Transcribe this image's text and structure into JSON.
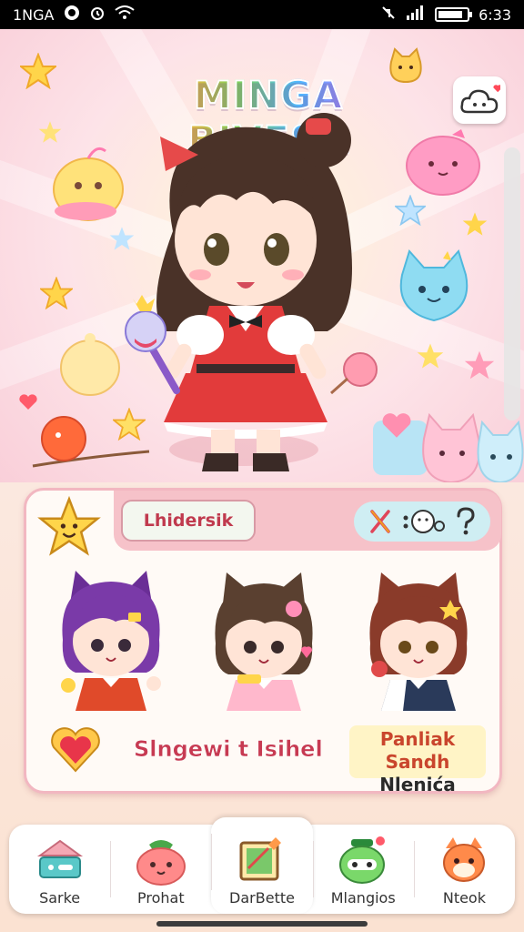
{
  "status_bar": {
    "left_text": "1NGA",
    "time": "6:33",
    "icons": [
      "notification-dot-icon",
      "alarm-icon",
      "wifi-icon",
      "mute-icon",
      "signal-icon",
      "battery-icon"
    ]
  },
  "header": {
    "title": "MINGA BIVESA",
    "cloud_button_icon": "cloud-heart-icon"
  },
  "hero": {
    "character": "chibi-girl-with-cat-ears-and-wand",
    "decorations": [
      "star-icon",
      "jelly-pet-icon",
      "cat-pet-icon",
      "heart-icon",
      "bubble-pet-icon"
    ]
  },
  "panel": {
    "badge_icon": "star-face-icon",
    "category_label": "Lhidersik",
    "tool_icons": [
      "scissors-icon",
      "face-icon",
      "question-icon"
    ],
    "stickers": [
      {
        "name": "purple-hair-cat-girl",
        "hair": "#7a3aa8"
      },
      {
        "name": "brown-hair-cat-girl",
        "hair": "#5a4030"
      },
      {
        "name": "auburn-hair-cat-girl",
        "hair": "#8a3b2a"
      }
    ],
    "caption_left": "Slngewi t Isihel",
    "caption_left_icon": "heart-badge-icon",
    "caption_right_line1": "Panliak Sandh",
    "caption_right_line2": "Nlenića"
  },
  "bottom_nav": {
    "items": [
      {
        "label": "Sarke",
        "icon": "chat-bubble-icon"
      },
      {
        "label": "Prohat",
        "icon": "strawberry-pet-icon"
      },
      {
        "label": "DarBette",
        "icon": "sketchbook-icon"
      },
      {
        "label": "Mlangios",
        "icon": "robot-pet-icon"
      },
      {
        "label": "Nteok",
        "icon": "fox-pet-icon"
      }
    ],
    "active_index": 2
  },
  "colors": {
    "accent_pink": "#f6c2c9",
    "title_red": "#c03a4e",
    "panel_border": "#f2b7c1"
  }
}
